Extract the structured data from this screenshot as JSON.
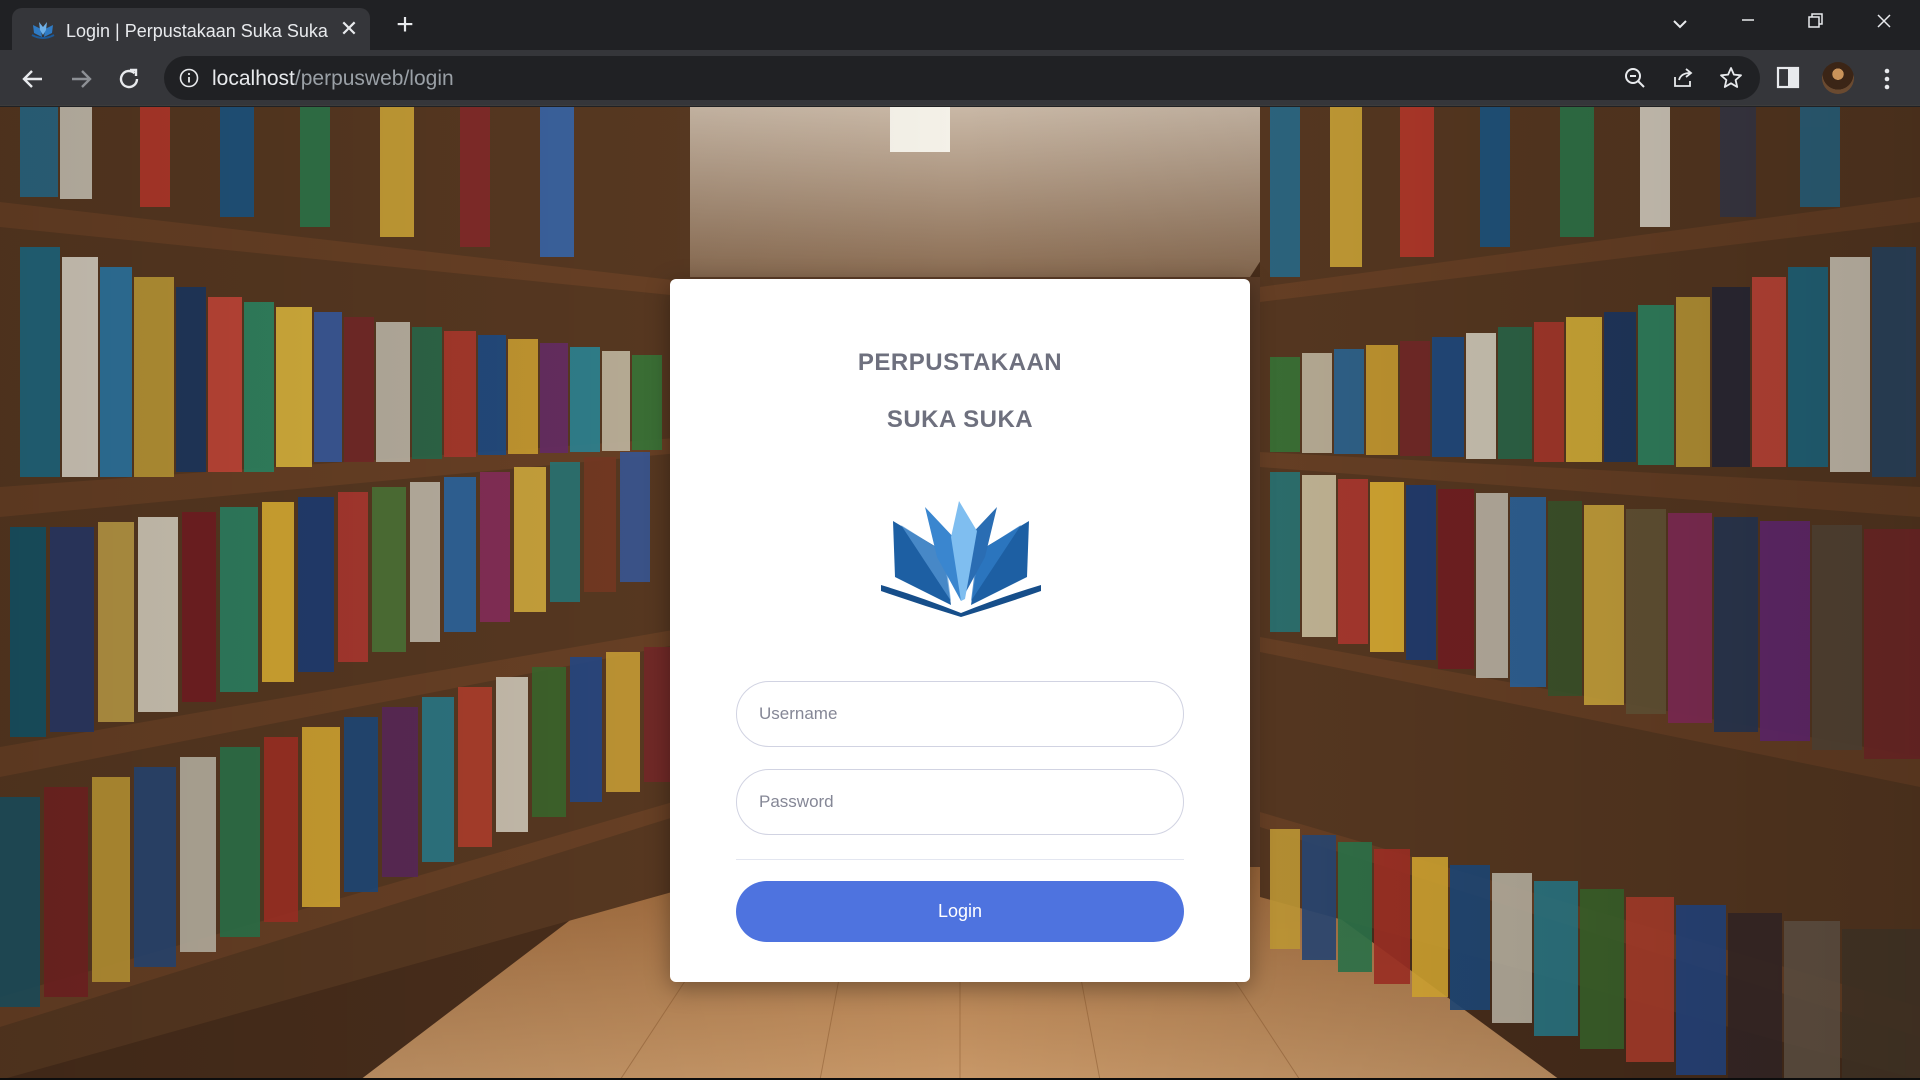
{
  "browser": {
    "tab": {
      "title": "Login | Perpustakaan Suka Suka",
      "favicon": "book-favicon"
    },
    "url": {
      "host": "localhost",
      "path": "/perpusweb/login"
    },
    "icons": [
      "back-arrow-icon",
      "forward-arrow-icon",
      "reload-icon",
      "info-icon",
      "zoom-icon",
      "share-icon",
      "star-icon",
      "side-panel-icon",
      "avatar",
      "kebab-menu-icon"
    ]
  },
  "login": {
    "title_line1": "PERPUSTAKAAN",
    "title_line2": "SUKA SUKA",
    "logo": "open-book-icon",
    "username_placeholder": "Username",
    "password_placeholder": "Password",
    "login_label": "Login"
  },
  "colors": {
    "primary": "#4e73df",
    "title_text": "#6e707e",
    "logo_blue": "#2a6db3",
    "chrome_dark": "#202124",
    "chrome_toolbar": "#35363a"
  }
}
